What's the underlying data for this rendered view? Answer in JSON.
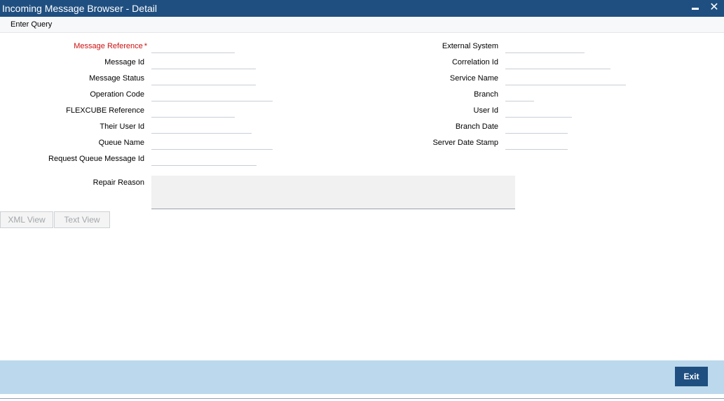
{
  "window": {
    "title": "Incoming Message Browser - Detail",
    "minimize_glyph": "",
    "close_glyph": "✕"
  },
  "toolbar": {
    "enter_query": "Enter Query"
  },
  "form_left": {
    "message_reference": {
      "label": "Message Reference",
      "required_mark": "*",
      "value": ""
    },
    "message_id": {
      "label": "Message Id",
      "value": ""
    },
    "message_status": {
      "label": "Message Status",
      "value": ""
    },
    "operation_code": {
      "label": "Operation Code",
      "value": ""
    },
    "flexcube_reference": {
      "label": "FLEXCUBE Reference",
      "value": ""
    },
    "their_user_id": {
      "label": "Their User Id",
      "value": ""
    },
    "queue_name": {
      "label": "Queue Name",
      "value": ""
    },
    "request_queue_message_id": {
      "label": "Request Queue Message Id",
      "value": ""
    }
  },
  "form_right": {
    "external_system": {
      "label": "External System",
      "value": ""
    },
    "correlation_id": {
      "label": "Correlation Id",
      "value": ""
    },
    "service_name": {
      "label": "Service Name",
      "value": ""
    },
    "branch": {
      "label": "Branch",
      "value": ""
    },
    "user_id": {
      "label": "User Id",
      "value": ""
    },
    "branch_date": {
      "label": "Branch Date",
      "value": ""
    },
    "server_date_stamp": {
      "label": "Server Date Stamp",
      "value": ""
    }
  },
  "repair_reason": {
    "label": "Repair Reason",
    "value": ""
  },
  "view_buttons": {
    "xml_view": "XML View",
    "text_view": "Text View"
  },
  "footer": {
    "exit": "Exit"
  },
  "colors": {
    "titlebar": "#1f4f80",
    "footer": "#bcd8ec",
    "required_label": "#cc1111",
    "exit_button": "#1f4f80"
  }
}
